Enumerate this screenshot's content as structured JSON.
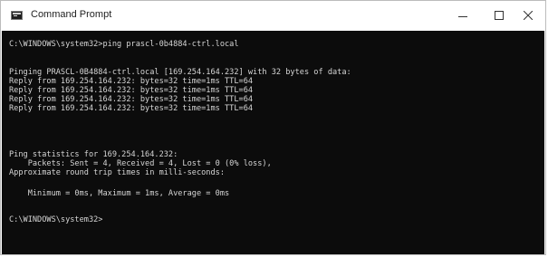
{
  "window": {
    "title": "Command Prompt"
  },
  "console": {
    "lines": [
      "C:\\WINDOWS\\system32>ping prascl-0b4884-ctrl.local",
      "",
      "Pinging PRASCL-0B4884-ctrl.local [169.254.164.232] with 32 bytes of data:",
      "Reply from 169.254.164.232: bytes=32 time=1ms TTL=64",
      "Reply from 169.254.164.232: bytes=32 time=1ms TTL=64",
      "Reply from 169.254.164.232: bytes=32 time=1ms TTL=64",
      "Reply from 169.254.164.232: bytes=32 time=1ms TTL=64",
      "",
      "Ping statistics for 169.254.164.232:",
      "    Packets: Sent = 4, Received = 4, Lost = 0 (0% loss),",
      "Approximate round trip times in milli-seconds:",
      "    Minimum = 0ms, Maximum = 1ms, Average = 0ms",
      "",
      "C:\\WINDOWS\\system32>"
    ]
  }
}
